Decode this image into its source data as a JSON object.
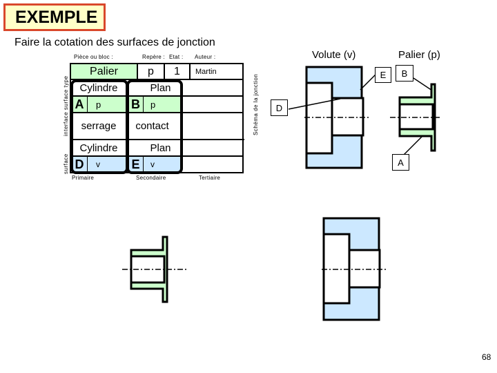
{
  "header": {
    "badge": "EXEMPLE",
    "subtitle": "Faire la cotation des surfaces de jonction"
  },
  "table": {
    "header_labels": {
      "piece": "Pièce ou bloc :",
      "repere": "Repère :",
      "etat": "Etat :",
      "auteur": "Auteur :"
    },
    "info_row": {
      "piece": "Palier",
      "repere": "p",
      "etat": "1",
      "auteur": "Martin"
    },
    "side_labels": {
      "top": "interface  surface  type",
      "bottom": "surface"
    },
    "vertical_caption": "Schéma de la jonction",
    "columns": [
      {
        "footer": "Primaire",
        "type_own": "Cylindre",
        "surface_own_letter": "A",
        "surface_own_piece": "p",
        "interface": "serrage",
        "type_other": "Cylindre",
        "surface_other_letter": "D",
        "surface_other_piece": "v"
      },
      {
        "footer": "Secondaire",
        "type_own": "Plan",
        "surface_own_letter": "B",
        "surface_own_piece": "p",
        "interface": "contact",
        "type_other": "Plan",
        "surface_other_letter": "E",
        "surface_other_piece": "v"
      },
      {
        "footer": "Tertiaire"
      }
    ]
  },
  "drawing": {
    "volute_title": "Volute (v)",
    "palier_title": "Palier (p)",
    "labels": {
      "E": "E",
      "B": "B",
      "D": "D",
      "A": "A"
    },
    "colors": {
      "volute_fill": "#cce8ff",
      "palier_fill": "#ccffcc",
      "badge_fill": "#ffffc8",
      "badge_border": "#d9472b"
    }
  },
  "page_number": "68"
}
